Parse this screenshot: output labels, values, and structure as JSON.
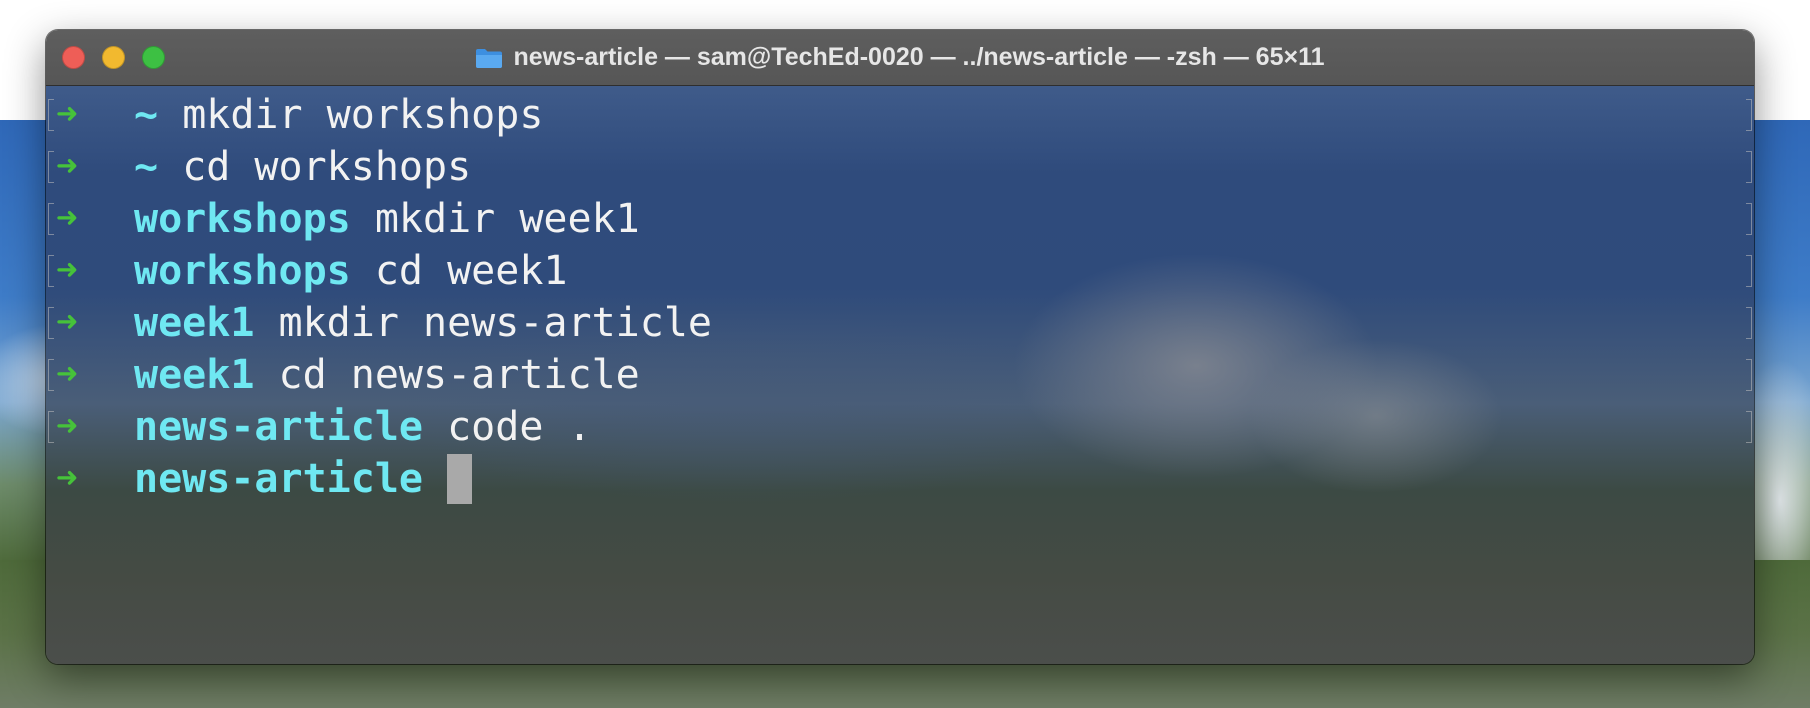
{
  "window": {
    "title": "news-article — sam@TechEd-0020 — ../news-article — -zsh — 65×11",
    "title_icon": "folder-icon",
    "controls": [
      "close",
      "minimize",
      "zoom"
    ]
  },
  "terminal": {
    "prompt_symbol": "➜",
    "lines": [
      {
        "dir": "~",
        "command": "mkdir workshops"
      },
      {
        "dir": "~",
        "command": "cd workshops"
      },
      {
        "dir": "workshops",
        "command": "mkdir week1"
      },
      {
        "dir": "workshops",
        "command": "cd week1"
      },
      {
        "dir": "week1",
        "command": "mkdir news-article"
      },
      {
        "dir": "week1",
        "command": "cd news-article"
      },
      {
        "dir": "news-article",
        "command": "code ."
      },
      {
        "dir": "news-article",
        "command": ""
      }
    ]
  },
  "colors": {
    "prompt_arrow": "#46c23a",
    "directory": "#6fe8f2",
    "text": "#f2f2f2",
    "cursor": "#a9a9a9"
  }
}
